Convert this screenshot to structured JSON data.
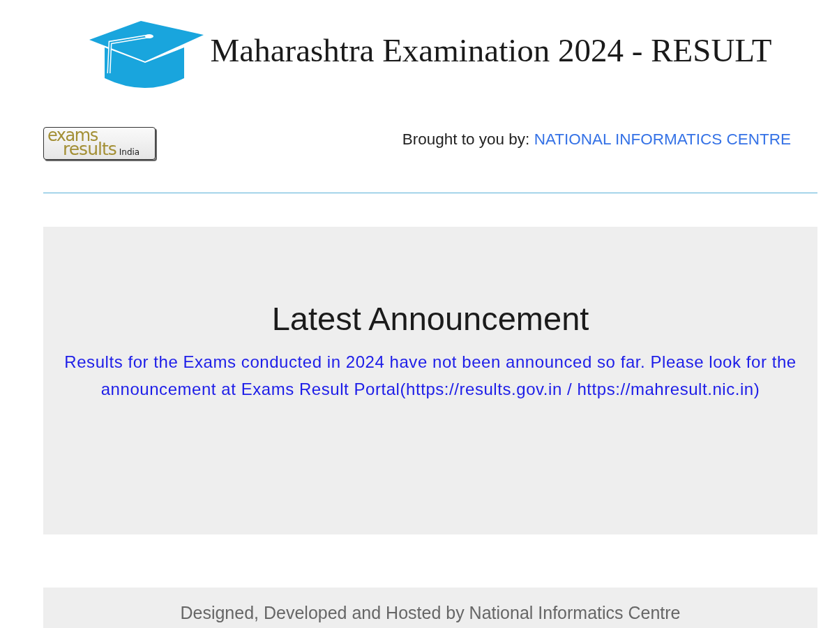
{
  "header": {
    "title": "Maharashtra Examination 2024 - RESULT"
  },
  "logo": {
    "word_1": "exams",
    "word_2": "results",
    "word_3": "India"
  },
  "credit": {
    "label": "Brought to you by:",
    "link": "NATIONAL INFORMATICS CENTRE"
  },
  "announcement": {
    "heading": "Latest Announcement",
    "message": "Results for the Exams conducted in 2024 have not been announced so far. Please look for the announcement at Exams Result Portal(https://results.gov.in / https://mahresult.nic.in)"
  },
  "footer": {
    "text": "Designed, Developed and Hosted by National Informatics Centre"
  }
}
